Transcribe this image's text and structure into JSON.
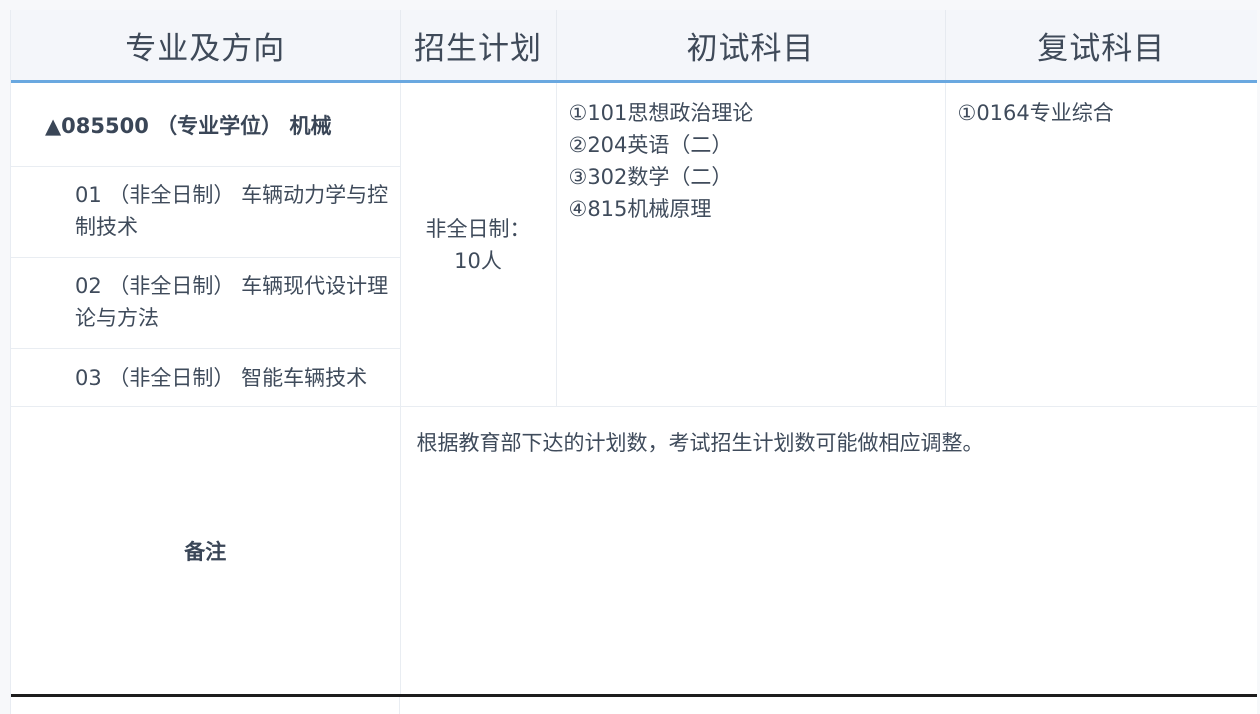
{
  "headers": {
    "major": "专业及方向",
    "plan": "招生计划",
    "initial_exam": "初试科目",
    "retest": "复试科目"
  },
  "major": {
    "title": "▲085500 （专业学位） 机械",
    "directions": [
      "01 （非全日制） 车辆动力学与控制技术",
      "02 （非全日制） 车辆现代设计理论与方法",
      "03 （非全日制） 智能车辆技术"
    ]
  },
  "plan": {
    "line1": "非全日制：",
    "line2": "10人"
  },
  "initial_subjects": [
    "①101思想政治理论",
    "②204英语（二）",
    "③302数学（二）",
    "④815机械原理"
  ],
  "retest_subjects": [
    "①0164专业综合"
  ],
  "note": {
    "label": "备注",
    "text": "根据教育部下达的计划数，考试招生计划数可能做相应调整。"
  },
  "colors": {
    "header_bg": "#f4f6fa",
    "header_underline": "#6aa8e0",
    "text": "#3f4b5b"
  }
}
